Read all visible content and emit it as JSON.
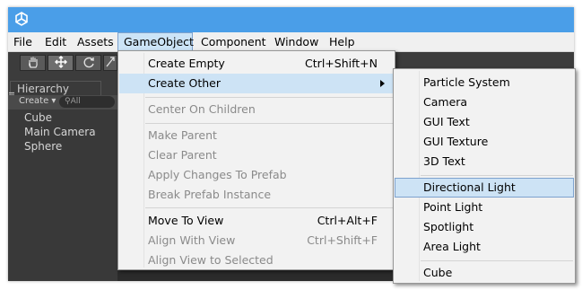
{
  "menubar": {
    "items": [
      "File",
      "Edit",
      "Assets",
      "GameObject",
      "Component",
      "Window",
      "Help"
    ]
  },
  "hierarchy": {
    "tab_title": "Hierarchy",
    "create_label": "Create",
    "search_placeholder": "All",
    "items": [
      "Cube",
      "Main Camera",
      "Sphere"
    ]
  },
  "gameobject_menu": {
    "items": [
      {
        "label": "Create Empty",
        "shortcut": "Ctrl+Shift+N",
        "enabled": true
      },
      {
        "label": "Create Other",
        "shortcut": "",
        "enabled": true,
        "submenu": true,
        "highlighted": true
      },
      {
        "label": "Center On Children",
        "shortcut": "",
        "enabled": false
      },
      {
        "label": "Make Parent",
        "shortcut": "",
        "enabled": false
      },
      {
        "label": "Clear Parent",
        "shortcut": "",
        "enabled": false
      },
      {
        "label": "Apply Changes To Prefab",
        "shortcut": "",
        "enabled": false
      },
      {
        "label": "Break Prefab Instance",
        "shortcut": "",
        "enabled": false
      },
      {
        "label": "Move To View",
        "shortcut": "Ctrl+Alt+F",
        "enabled": true
      },
      {
        "label": "Align With View",
        "shortcut": "Ctrl+Shift+F",
        "enabled": false
      },
      {
        "label": "Align View to Selected",
        "shortcut": "",
        "enabled": false
      }
    ]
  },
  "create_other_menu": {
    "items": [
      {
        "label": "Particle System"
      },
      {
        "label": "Camera"
      },
      {
        "label": "GUI Text"
      },
      {
        "label": "GUI Texture"
      },
      {
        "label": "3D Text"
      },
      {
        "label": "Directional Light",
        "highlighted": true
      },
      {
        "label": "Point Light"
      },
      {
        "label": "Spotlight"
      },
      {
        "label": "Area Light"
      },
      {
        "label": "Cube"
      }
    ]
  },
  "colors": {
    "titlebar": "#4a9ee8",
    "editor_dark": "#3c3c3c",
    "menu_bg": "#f2f2f2",
    "highlight": "#cde3f5",
    "highlight_border": "#7da2ce",
    "disabled_text": "#8a8a8a"
  },
  "icons": [
    "unity-logo-icon",
    "hand-tool-icon",
    "move-tool-icon",
    "rotate-tool-icon",
    "scale-tool-icon",
    "hierarchy-list-icon",
    "search-icon",
    "dropdown-arrow-icon",
    "submenu-arrow-icon"
  ]
}
